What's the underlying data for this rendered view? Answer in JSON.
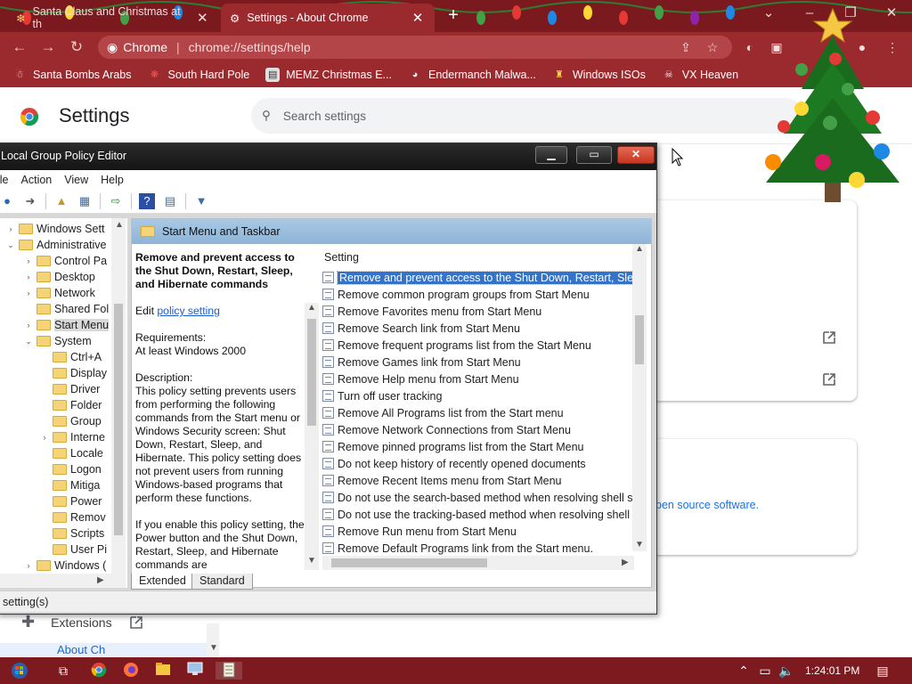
{
  "browser": {
    "tabs": [
      {
        "title": "Santa Claus and Christmas at th",
        "close": "✕"
      },
      {
        "title": "Settings - About Chrome",
        "close": "✕"
      }
    ],
    "new_tab": "+",
    "address": {
      "site": "Chrome",
      "path": "chrome://settings/help"
    },
    "bookmarks": [
      {
        "label": "Santa Bombs Arabs",
        "icon": "santa-icon"
      },
      {
        "label": "South Hard Pole",
        "icon": "snowflake-icon"
      },
      {
        "label": "MEMZ Christmas E...",
        "icon": "memz-icon"
      },
      {
        "label": "Endermanch Malwa...",
        "icon": "raccoon-icon"
      },
      {
        "label": "Windows ISOs",
        "icon": "pin-icon"
      },
      {
        "label": "VX Heaven",
        "icon": "skull-icon"
      }
    ]
  },
  "settings": {
    "title": "Settings",
    "search_placeholder": "Search settings",
    "oss_link": "pen source software.",
    "sidebar_extensions": "Extensions",
    "sidebar_about": "About Ch"
  },
  "gpo": {
    "window_title": "Local Group Policy Editor",
    "menu": [
      "ile",
      "Action",
      "View",
      "Help"
    ],
    "tree": [
      {
        "label": "Windows Sett",
        "level": 1,
        "arrow": "›"
      },
      {
        "label": "Administrative",
        "level": 1,
        "arrow": "⌄"
      },
      {
        "label": "Control Pa",
        "level": 2,
        "arrow": "›"
      },
      {
        "label": "Desktop",
        "level": 2,
        "arrow": "›"
      },
      {
        "label": "Network",
        "level": 2,
        "arrow": "›"
      },
      {
        "label": "Shared Fol",
        "level": 2,
        "arrow": ""
      },
      {
        "label": "Start Menu",
        "level": 2,
        "arrow": "›",
        "selected": true
      },
      {
        "label": "System",
        "level": 2,
        "arrow": "⌄"
      },
      {
        "label": "Ctrl+A",
        "level": 3,
        "arrow": ""
      },
      {
        "label": "Display",
        "level": 3,
        "arrow": ""
      },
      {
        "label": "Driver",
        "level": 3,
        "arrow": ""
      },
      {
        "label": "Folder",
        "level": 3,
        "arrow": ""
      },
      {
        "label": "Group",
        "level": 3,
        "arrow": ""
      },
      {
        "label": "Interne",
        "level": 3,
        "arrow": "›"
      },
      {
        "label": "Locale",
        "level": 3,
        "arrow": ""
      },
      {
        "label": "Logon",
        "level": 3,
        "arrow": ""
      },
      {
        "label": "Mitiga",
        "level": 3,
        "arrow": ""
      },
      {
        "label": "Power",
        "level": 3,
        "arrow": ""
      },
      {
        "label": "Remov",
        "level": 3,
        "arrow": ""
      },
      {
        "label": "Scripts",
        "level": 3,
        "arrow": ""
      },
      {
        "label": "User Pi",
        "level": 3,
        "arrow": ""
      },
      {
        "label": "Windows (",
        "level": 2,
        "arrow": "›"
      }
    ],
    "header": "Start Menu and Taskbar",
    "description": {
      "title": "Remove and prevent access to the Shut Down, Restart, Sleep, and Hibernate commands",
      "edit_prefix": "Edit ",
      "edit_link": "policy setting ",
      "requirements_label": "Requirements:",
      "requirements_value": "At least Windows 2000",
      "description_label": "Description:",
      "description_text": "This policy setting prevents users from performing the following commands from the Start menu or Windows Security screen: Shut Down, Restart, Sleep, and Hibernate. This policy setting does not prevent users from running Windows-based programs that perform these functions.",
      "enable_text": "If you enable this policy setting, the Power button and the Shut Down, Restart, Sleep, and Hibernate commands are"
    },
    "column_header": "Setting",
    "settings": [
      "Remove and prevent access to the Shut Down, Restart, Sleep...",
      "Remove common program groups from Start Menu",
      "Remove Favorites menu from Start Menu",
      "Remove Search link from Start Menu",
      "Remove frequent programs list from the Start Menu",
      "Remove Games link from Start Menu",
      "Remove Help menu from Start Menu",
      "Turn off user tracking",
      "Remove All Programs list from the Start menu",
      "Remove Network Connections from Start Menu",
      "Remove pinned programs list from the Start Menu",
      "Do not keep history of recently opened documents",
      "Remove Recent Items menu from Start Menu",
      "Do not use the search-based method when resolving shell s...",
      "Do not use the tracking-based method when resolving shell ...",
      "Remove Run menu from Start Menu",
      "Remove Default Programs link from the Start menu."
    ],
    "selected_index": 0,
    "view_tabs": [
      "Extended",
      "Standard"
    ],
    "status": "setting(s)"
  },
  "taskbar": {
    "time": "1:24:01 PM"
  }
}
